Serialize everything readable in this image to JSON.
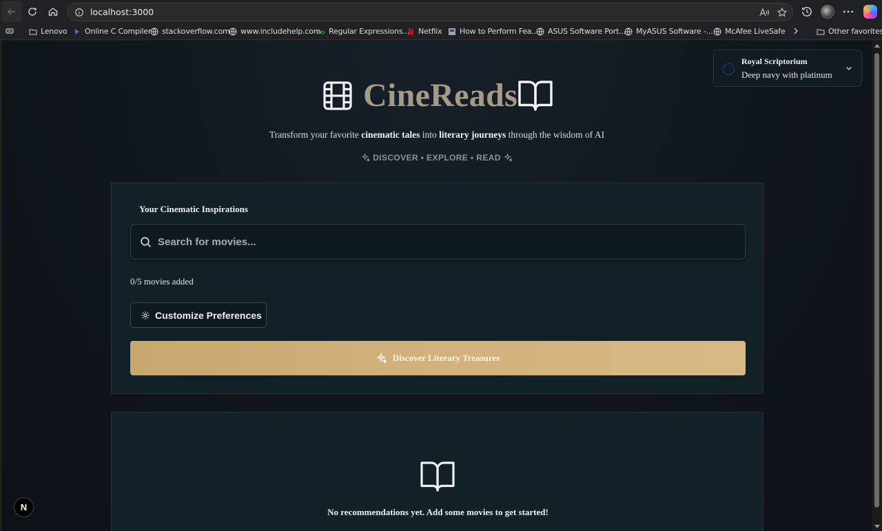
{
  "browser": {
    "url": "localhost:3000",
    "bookmarks": [
      {
        "label": "Lenovo",
        "icon": "folder-icon"
      },
      {
        "label": "Online C Compiler",
        "icon": "programiz-icon"
      },
      {
        "label": "stackoverflow.com",
        "icon": "globe-icon"
      },
      {
        "label": "www.includehelp.com",
        "icon": "globe-icon"
      },
      {
        "label": "Regular Expressions...",
        "icon": "regex-icon"
      },
      {
        "label": "Netflix",
        "icon": "netflix-icon"
      },
      {
        "label": "How to Perform Fea...",
        "icon": "page-icon"
      },
      {
        "label": "ASUS Software Port...",
        "icon": "globe-icon"
      },
      {
        "label": "MyASUS Software -...",
        "icon": "globe-icon"
      },
      {
        "label": "McAfee LiveSafe",
        "icon": "globe-icon"
      }
    ],
    "other_favorites": "Other favorites"
  },
  "theme": {
    "name": "Royal Scriptorium",
    "description": "Deep navy with platinum"
  },
  "hero": {
    "title": "CineReads",
    "tagline_part1": "Transform your favorite ",
    "tagline_bold1": "cinematic tales",
    "tagline_part2": " into ",
    "tagline_bold2": "literary journeys",
    "tagline_part3": " through the wisdom of AI",
    "subtag": "DISCOVER • EXPLORE • READ"
  },
  "inspirations": {
    "heading": "Your Cinematic Inspirations",
    "search_placeholder": "Search for movies...",
    "count_text": "0/5 movies added",
    "customize_label": "Customize Preferences",
    "discover_label": "Discover Literary Treasures"
  },
  "recommendations": {
    "empty_text": "No recommendations yet. Add some movies to get started!"
  },
  "next_badge": "N"
}
